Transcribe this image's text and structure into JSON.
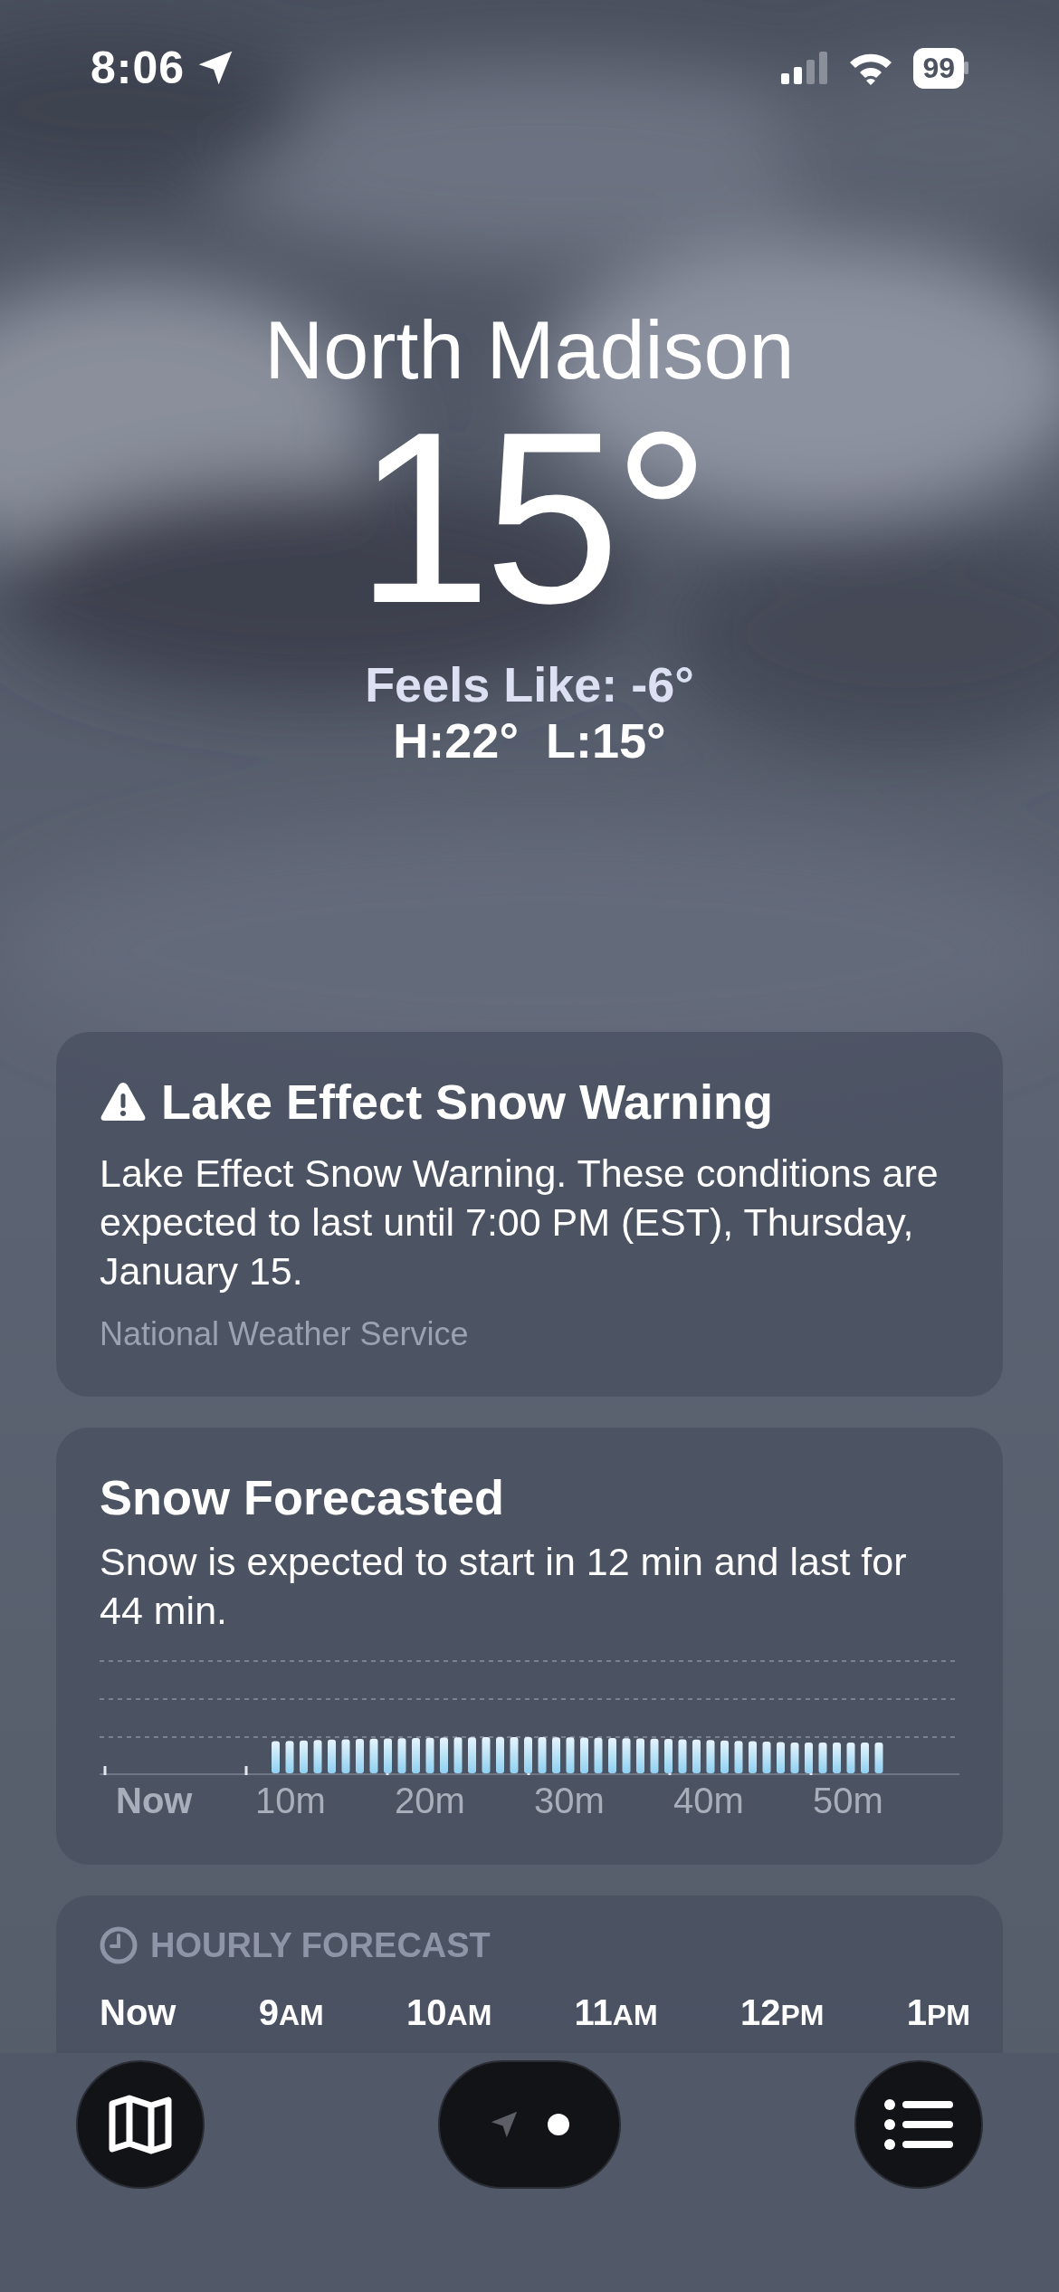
{
  "status_bar": {
    "time": "8:06",
    "battery": "99"
  },
  "location": {
    "city": "North Madison",
    "temperature": "15°",
    "feels_like": "Feels Like: -6°",
    "high": "H:22°",
    "low": "L:15°"
  },
  "alert": {
    "title": "Lake Effect Snow Warning",
    "body": "Lake Effect Snow Warning. These conditions are expected to last until 7:00 PM (EST), Thursday, January 15.",
    "source": "National Weather Service"
  },
  "precipitation": {
    "title": "Snow Forecasted",
    "summary": "Snow is expected to start in 12 min and last for 44 min.",
    "axis_labels": [
      "Now",
      "10m",
      "20m",
      "30m",
      "40m",
      "50m"
    ]
  },
  "hourly": {
    "title": "HOURLY FORECAST",
    "hours": [
      {
        "hour": "Now"
      },
      {
        "hour": "9",
        "suffix": "AM"
      },
      {
        "hour": "10",
        "suffix": "AM"
      },
      {
        "hour": "11",
        "suffix": "AM"
      },
      {
        "hour": "12",
        "suffix": "PM"
      },
      {
        "hour": "1",
        "suffix": "PM"
      }
    ]
  },
  "page_indicator": [
    {
      "kind": "location",
      "selected": false
    },
    {
      "kind": "dot",
      "selected": true
    }
  ]
}
